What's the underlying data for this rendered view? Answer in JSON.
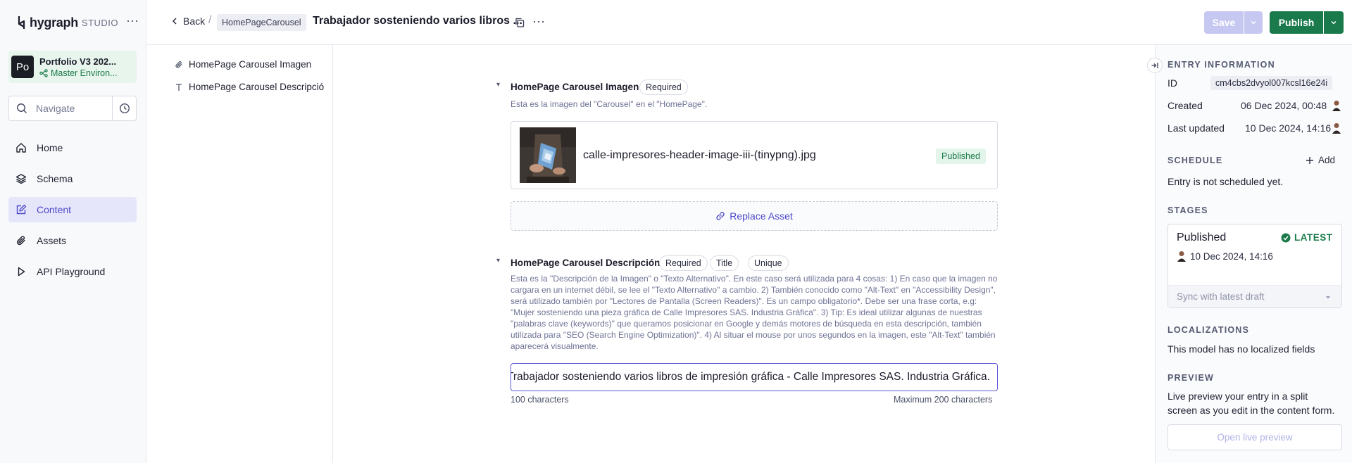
{
  "brand": {
    "name": "hygraph",
    "product": "STUDIO"
  },
  "project": {
    "avatar": "Po",
    "name": "Portfolio V3 202...",
    "environment": "Master Environ..."
  },
  "navigate": {
    "placeholder": "Navigate"
  },
  "nav": {
    "items": [
      {
        "label": "Home",
        "icon": "home-icon"
      },
      {
        "label": "Schema",
        "icon": "layers-icon"
      },
      {
        "label": "Content",
        "icon": "content-icon",
        "active": true
      },
      {
        "label": "Assets",
        "icon": "paperclip-icon"
      },
      {
        "label": "API Playground",
        "icon": "play-icon"
      }
    ]
  },
  "header": {
    "back": "Back",
    "model": "HomePageCarousel",
    "title": "Trabajador sosteniendo varios libros ...",
    "save": "Save",
    "publish": "Publish"
  },
  "tree": {
    "items": [
      {
        "label": "HomePage Carousel Imagen",
        "icon": "paperclip-icon"
      },
      {
        "label": "HomePage Carousel Descripción",
        "icon": "text-icon"
      }
    ]
  },
  "fields": {
    "image": {
      "label": "HomePage Carousel Imagen",
      "badges": [
        "Required"
      ],
      "description": "Esta es la imagen del \"Carousel\" en el \"HomePage\".",
      "asset_name": "calle-impresores-header-image-iii-(tinypng).jpg",
      "asset_status": "Published",
      "replace": "Replace Asset"
    },
    "description": {
      "label": "HomePage Carousel Descripción",
      "badges": [
        "Required",
        "Title",
        "Unique"
      ],
      "description": "Esta es la \"Descripción de la Imagen\" o \"Texto Alternativo\". En este caso será utilizada para 4 cosas: 1) En caso que la imagen no cargara en un internet débil, se lee el \"Texto Alternativo\" a cambio. 2) También conocido como \"Alt-Text\" en \"Accessibility Design\", será utilizado también por \"Lectores de Pantalla (Screen Readers)\". Es un campo obligatorio*. Debe ser una frase corta, e.g: \"Mujer sosteniendo una pieza gráfica de Calle Impresores SAS. Industria Gráfica\". 3) Tip: Es ideal utilizar algunas de nuestras \"palabras clave (keywords)\" que queramos posicionar en Google y demás motores de búsqueda en esta descripción, también utilizada para \"SEO (Search Engine Optimization)\". 4) Al situar el mouse por unos segundos en la imagen, este \"Alt-Text\" también aparecerá visualmente.",
      "value": "Trabajador sosteniendo varios libros de impresión gráfica - Calle Impresores SAS. Industria Gráfica.",
      "count": "100 characters",
      "max": "Maximum 200 characters"
    }
  },
  "panel": {
    "entry_info_title": "ENTRY INFORMATION",
    "id_label": "ID",
    "id_value": "cm4cbs2dvyol007kcsl16e24i",
    "created_label": "Created",
    "created_value": "06 Dec 2024, 00:48",
    "updated_label": "Last updated",
    "updated_value": "10 Dec 2024, 14:16",
    "schedule_title": "SCHEDULE",
    "schedule_add": "Add",
    "schedule_text": "Entry is not scheduled yet.",
    "stages_title": "STAGES",
    "stage_name": "Published",
    "stage_latest": "LATEST",
    "stage_date": "10 Dec 2024, 14:16",
    "stage_sync": "Sync with latest draft",
    "localizations_title": "LOCALIZATIONS",
    "localizations_text": "This model has no localized fields",
    "preview_title": "PREVIEW",
    "preview_text": "Live preview your entry in a split screen as you edit in the content form.",
    "preview_button": "Open live preview"
  },
  "colors": {
    "accent": "#4d48c9",
    "publish": "#1a7a4c",
    "save_disabled": "#c7c8f1",
    "active_nav_bg": "#e6e6fa",
    "environment": "#e7f5ed"
  }
}
